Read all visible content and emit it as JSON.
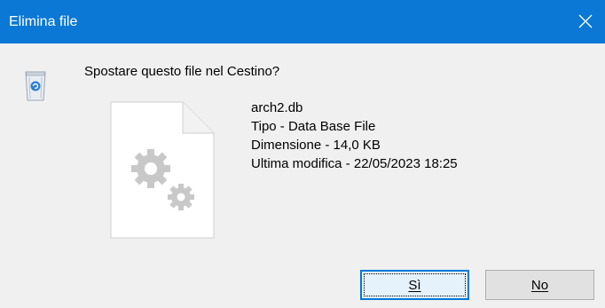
{
  "window": {
    "title": "Elimina file",
    "close_icon": "close-icon"
  },
  "message": {
    "question": "Spostare questo file nel Cestino?",
    "icon": "recycle-bin-icon"
  },
  "file": {
    "icon": "generic-file-gears-icon",
    "name": "arch2.db",
    "type_line": "Tipo - Data Base File",
    "size_line": "Dimensione - 14,0 KB",
    "modified_line": "Ultima modifica - 22/05/2023 18:25"
  },
  "buttons": {
    "yes_label": "Sì",
    "no_label": "No"
  },
  "colors": {
    "titlebar": "#0a78d4",
    "dialog_background": "#f0f0f0",
    "default_button_border": "#0078d7"
  }
}
